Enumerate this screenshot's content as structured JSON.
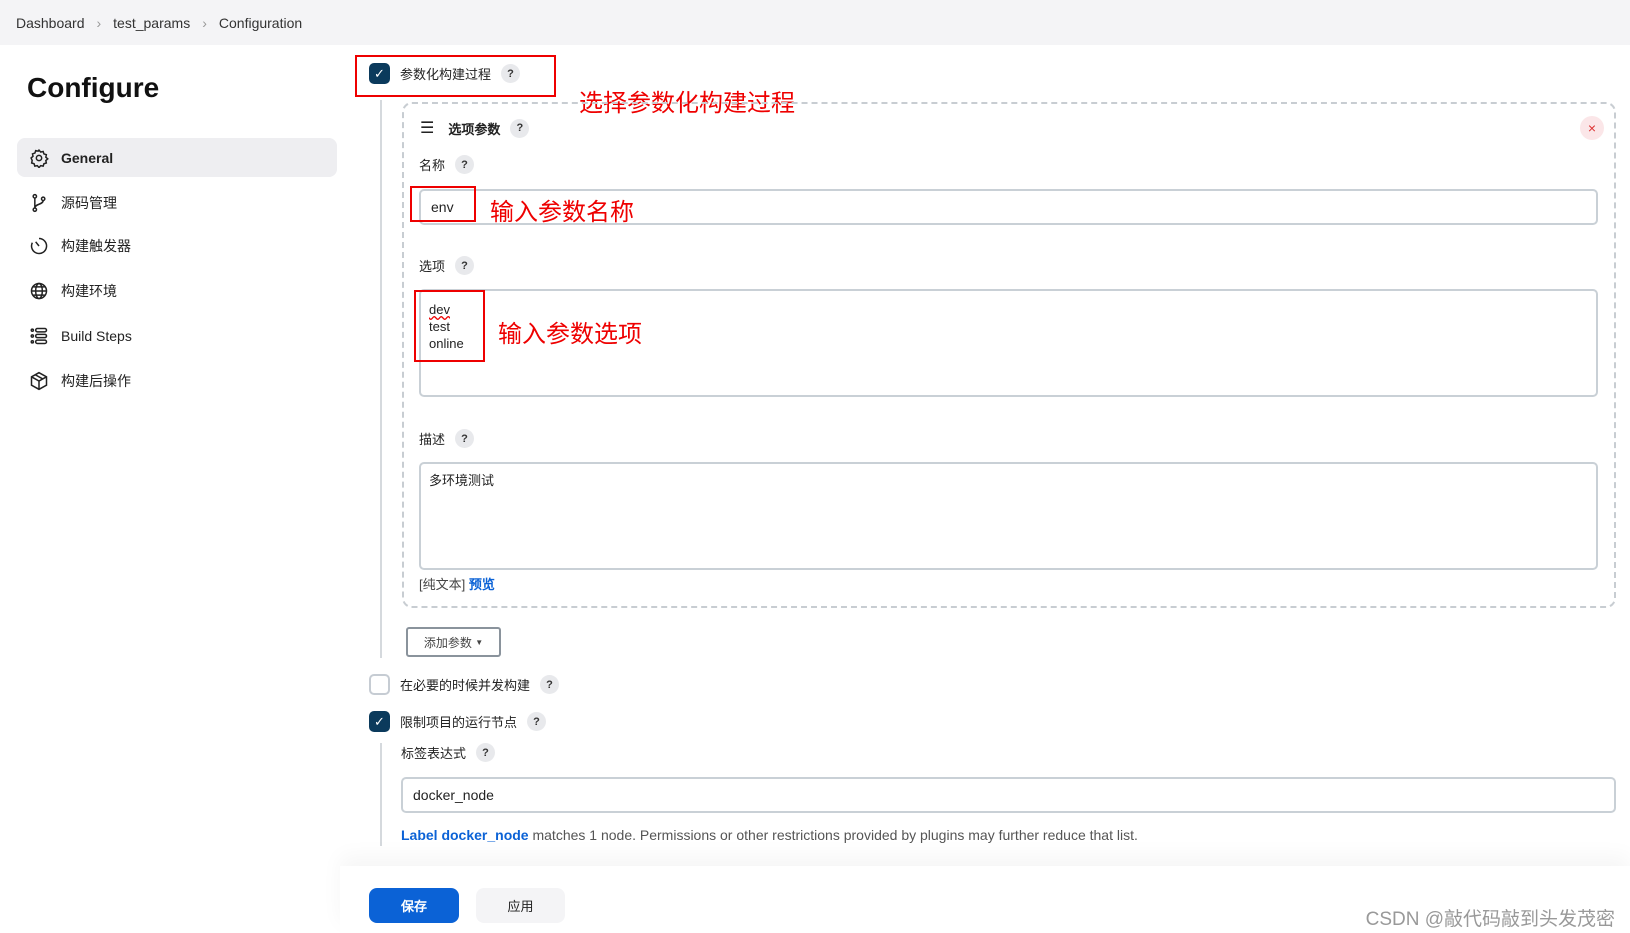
{
  "breadcrumb": [
    "Dashboard",
    "test_params",
    "Configuration"
  ],
  "page_title": "Configure",
  "sidebar": {
    "items": [
      {
        "label": "General",
        "icon": "gear-icon",
        "active": true
      },
      {
        "label": "源码管理",
        "icon": "branch-icon"
      },
      {
        "label": "构建触发器",
        "icon": "timer-icon"
      },
      {
        "label": "构建环境",
        "icon": "globe-icon"
      },
      {
        "label": "Build Steps",
        "icon": "list-icon"
      },
      {
        "label": "构建后操作",
        "icon": "package-icon"
      }
    ]
  },
  "parameterized": {
    "label": "参数化构建过程",
    "checked": true
  },
  "param": {
    "title": "选项参数",
    "name_label": "名称",
    "name_value": "env",
    "choices_label": "选项",
    "choices_lines": [
      "dev",
      "test",
      "online"
    ],
    "desc_label": "描述",
    "desc_value": "多环境测试",
    "plain_text": "[纯文本]",
    "preview": "预览"
  },
  "add_param": "添加参数",
  "concurrent": {
    "label": "在必要的时候并发构建",
    "checked": false
  },
  "restrict": {
    "label": "限制项目的运行节点",
    "checked": true,
    "expr_label": "标签表达式",
    "expr_value": "docker_node",
    "info_link": "Label docker_node",
    "info_text": " matches 1 node. Permissions or other restrictions provided by plugins may further reduce that list."
  },
  "annotations": {
    "a1": "选择参数化构建过程",
    "a2": "输入参数名称",
    "a3": "输入参数选项"
  },
  "buttons": {
    "save": "保存",
    "apply": "应用"
  },
  "help": "?",
  "watermark": "CSDN @敲代码敲到头发茂密",
  "colors": {
    "accent": "#0b62d6",
    "checkbox": "#0b3a5c",
    "annotation": "#ee0000"
  }
}
